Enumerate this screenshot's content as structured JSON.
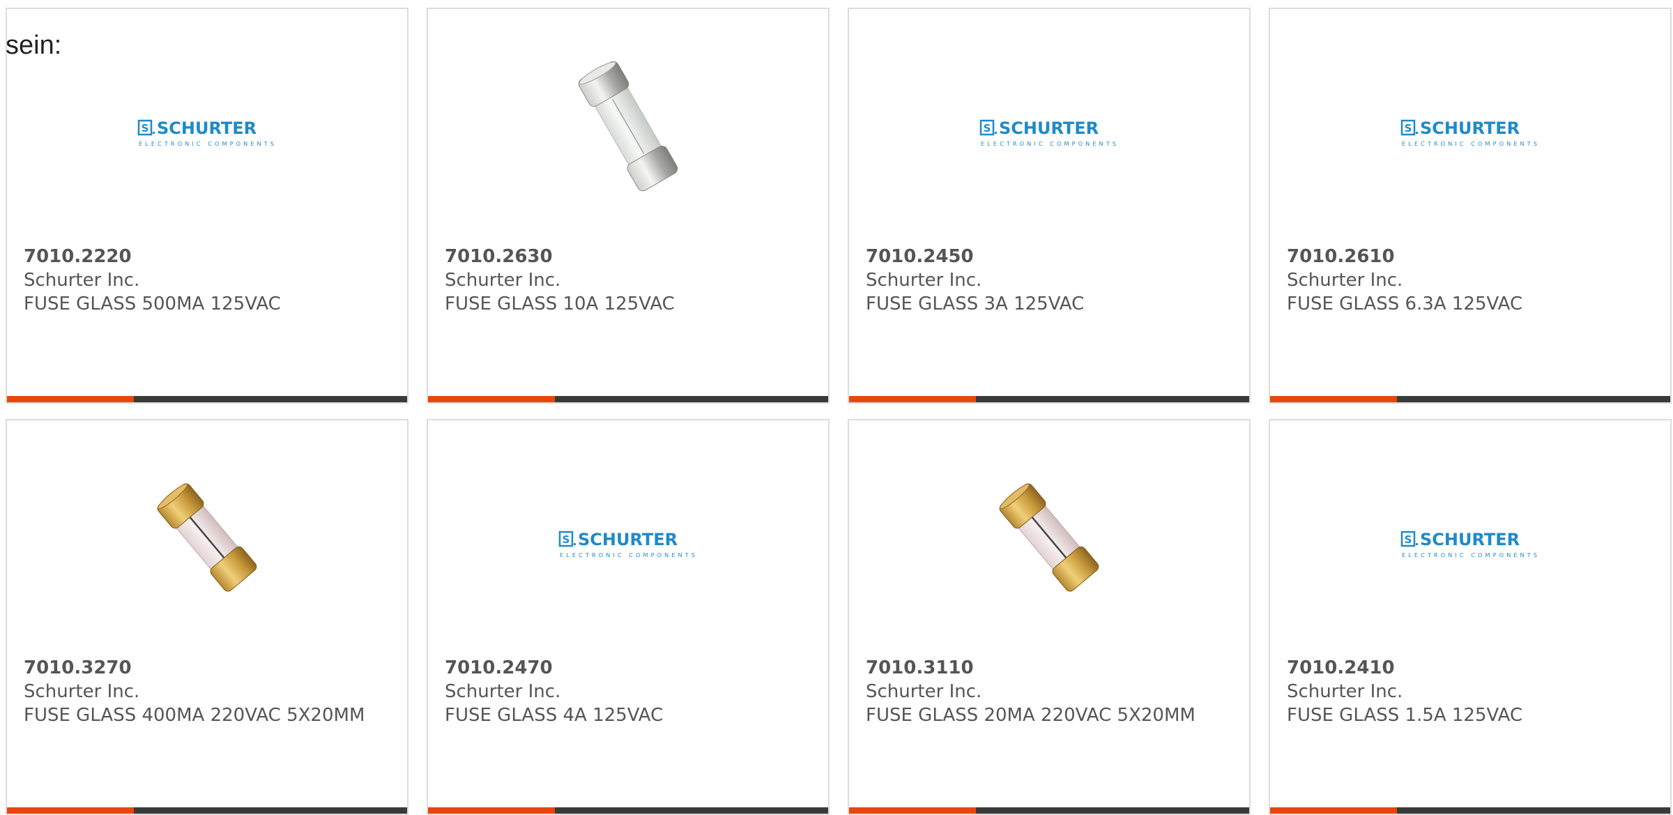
{
  "intro": {
    "text": "sein:"
  },
  "brand": {
    "logo_name": "SCHURTER",
    "logo_sub": "ELECTRONIC COMPONENTS",
    "color": "#1f8ac9"
  },
  "colors": {
    "accent": "#e8470b",
    "bar": "#3a3a3a",
    "border": "#dcdcdc"
  },
  "products": [
    {
      "part_number": "7010.2220",
      "manufacturer": "Schurter Inc.",
      "description": "FUSE GLASS 500MA 125VAC",
      "image": "schurter-logo"
    },
    {
      "part_number": "7010.2630",
      "manufacturer": "Schurter Inc.",
      "description": "FUSE GLASS 10A 125VAC",
      "image": "fuse-silver-icon"
    },
    {
      "part_number": "7010.2450",
      "manufacturer": "Schurter Inc.",
      "description": "FUSE GLASS 3A 125VAC",
      "image": "schurter-logo"
    },
    {
      "part_number": "7010.2610",
      "manufacturer": "Schurter Inc.",
      "description": "FUSE GLASS 6.3A 125VAC",
      "image": "schurter-logo"
    },
    {
      "part_number": "7010.3270",
      "manufacturer": "Schurter Inc.",
      "description": "FUSE GLASS 400MA 220VAC 5X20MM",
      "image": "fuse-gold-icon"
    },
    {
      "part_number": "7010.2470",
      "manufacturer": "Schurter Inc.",
      "description": "FUSE GLASS 4A 125VAC",
      "image": "schurter-logo"
    },
    {
      "part_number": "7010.3110",
      "manufacturer": "Schurter Inc.",
      "description": "FUSE GLASS 20MA 220VAC 5X20MM",
      "image": "fuse-gold-icon"
    },
    {
      "part_number": "7010.2410",
      "manufacturer": "Schurter Inc.",
      "description": "FUSE GLASS 1.5A 125VAC",
      "image": "schurter-logo"
    }
  ]
}
